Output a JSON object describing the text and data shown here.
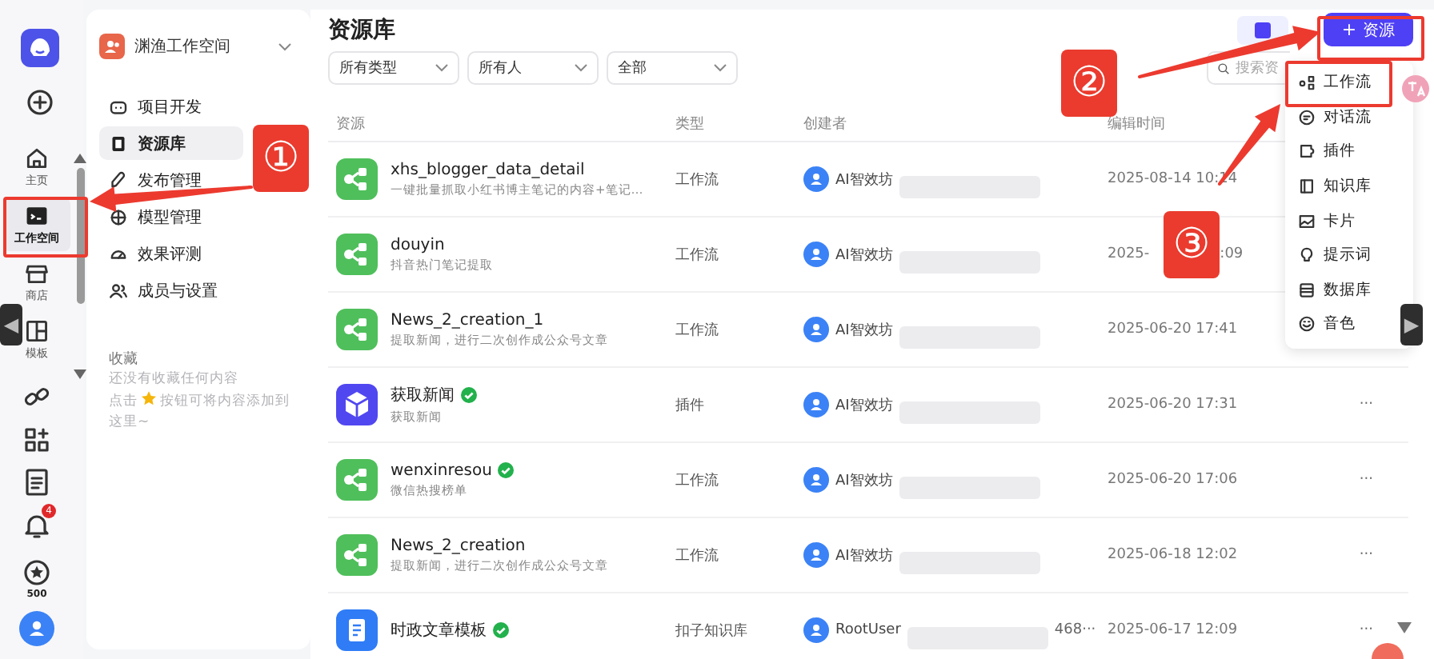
{
  "rail": {
    "items": [
      {
        "label": "主页",
        "selected": false
      },
      {
        "label": "工作空间",
        "selected": true
      },
      {
        "label": "商店",
        "selected": false
      },
      {
        "label": "模板",
        "selected": false
      }
    ],
    "notification_badge": "4",
    "points": "500"
  },
  "workspace": {
    "name": "渊渔工作空间"
  },
  "nav": {
    "items": [
      {
        "label": "项目开发",
        "selected": false
      },
      {
        "label": "资源库",
        "selected": true
      },
      {
        "label": "发布管理",
        "selected": false
      },
      {
        "label": "模型管理",
        "selected": false
      },
      {
        "label": "效果评测",
        "selected": false
      },
      {
        "label": "成员与设置",
        "selected": false
      }
    ],
    "favorites": {
      "title": "收藏",
      "empty_text": "还没有收藏任何内容",
      "hint_before": "点击",
      "hint_after": "按钮可将内容添加到",
      "hint_end": "这里~"
    }
  },
  "page": {
    "title": "资源库",
    "create_button": {
      "icon_text": "+",
      "label": "资源"
    }
  },
  "filters": [
    {
      "value": "所有类型"
    },
    {
      "value": "所有人"
    },
    {
      "value": "全部"
    }
  ],
  "search": {
    "placeholder": "搜索资"
  },
  "table": {
    "columns": [
      "资源",
      "类型",
      "创建者",
      "编辑时间"
    ],
    "rows": [
      {
        "kind": "workflow",
        "name": "xhs_blogger_data_detail",
        "verified": false,
        "description": "一键批量抓取小红书博主笔记的内容+笔记…",
        "type": "工作流",
        "creator": "AI智效坊",
        "time": "2025-08-14 10:14"
      },
      {
        "kind": "workflow",
        "name": "douyin",
        "verified": false,
        "description": "抖音热门笔记提取",
        "type": "工作流",
        "creator": "AI智效坊",
        "time": "2025-",
        "time_end": ":09"
      },
      {
        "kind": "workflow",
        "name": "News_2_creation_1",
        "verified": false,
        "description": "提取新闻，进行二次创作成公众号文章",
        "type": "工作流",
        "creator": "AI智效坊",
        "time": "2025-06-20 17:41"
      },
      {
        "kind": "plugin",
        "name": "获取新闻",
        "verified": true,
        "description": "获取新闻",
        "type": "插件",
        "creator": "AI智效坊",
        "time": "2025-06-20 17:31",
        "actions": "···"
      },
      {
        "kind": "workflow",
        "name": "wenxinresou",
        "verified": true,
        "description": "微信热搜榜单",
        "type": "工作流",
        "creator": "AI智效坊",
        "time": "2025-06-20 17:06",
        "actions": "···"
      },
      {
        "kind": "workflow",
        "name": "News_2_creation",
        "verified": false,
        "description": "提取新闻，进行二次创作成公众号文章",
        "type": "工作流",
        "creator": "AI智效坊",
        "time": "2025-06-18 12:02",
        "actions": "···"
      },
      {
        "kind": "knowledge",
        "name": "时政文章模板",
        "verified": true,
        "type": "扣子知识库",
        "creator": "RootUser",
        "creator_suffix": "468···",
        "time": "2025-06-17 12:09",
        "actions": "···"
      }
    ]
  },
  "create_menu": {
    "items": [
      "工作流",
      "对话流",
      "插件",
      "知识库",
      "卡片",
      "提示词",
      "数据库",
      "音色"
    ]
  },
  "side_tabs": [
    {
      "text": "◀"
    },
    {
      "text": "▶"
    }
  ],
  "annotations": [
    {
      "text": "①"
    },
    {
      "text": "②"
    },
    {
      "text": "③"
    }
  ]
}
